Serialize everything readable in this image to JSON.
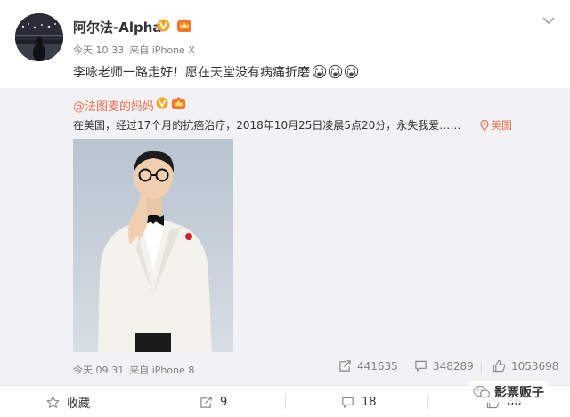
{
  "post": {
    "author": "阿尔法-Alpha",
    "time": "今天 10:33",
    "source": "来自 iPhone X",
    "text": "李咏老师一路走好！愿在天堂没有病痛折磨",
    "emojis": [
      "crying-face-emoji",
      "crying-face-emoji",
      "crying-face-emoji"
    ]
  },
  "repost": {
    "author": "@法图麦的妈妈",
    "text": "在美国，经过17个月的抗癌治疗，2018年10月25日凌晨5点20分，永失我爱……",
    "location": "美国",
    "time": "今天 09:31",
    "source": "来自 iPhone 8",
    "reposts": "441635",
    "comments": "348289",
    "likes": "1053698"
  },
  "actions": {
    "favorite_label": "收藏",
    "repost_count": "9",
    "comment_count": "18",
    "like_count": "86"
  },
  "watermark": {
    "text": "影票贩子"
  },
  "colors": {
    "accent": "#eb7350",
    "verified": "#f5a623",
    "repost_bg": "#f2f2f5",
    "meta_text": "#808080"
  },
  "icons": {
    "verified": "verified-v-icon",
    "vip": "vip-crown-icon",
    "location": "location-pin-icon",
    "repost": "repost-icon",
    "comment": "comment-icon",
    "like": "thumbs-up-icon",
    "favorite": "star-icon",
    "menu": "chevron-down-icon"
  }
}
